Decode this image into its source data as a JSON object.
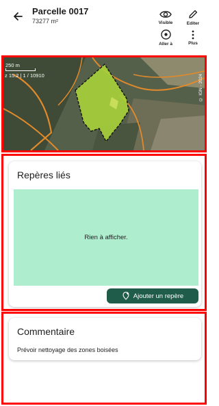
{
  "header": {
    "back_icon": "arrow-left-icon",
    "title": "Parcelle 0017",
    "subtitle": "73277 m²",
    "actions": [
      {
        "label": "Visible",
        "icon": "eye-icon"
      },
      {
        "label": "Editer",
        "icon": "pencil-icon"
      },
      {
        "label": "Aller à",
        "icon": "target-icon"
      },
      {
        "label": "Plus",
        "icon": "more-vertical-icon"
      }
    ]
  },
  "map": {
    "scale_label": "250 m",
    "zoom_label": "z 15.2 | 1 / 10910",
    "copyright": "© IGN - 2024",
    "colors": {
      "parcel_fill": "#a9d13a",
      "road": "#e08a2c",
      "highlight_border": "#ff0000"
    }
  },
  "linked": {
    "title": "Repères liés",
    "empty_text": "Rien à afficher.",
    "add_label": "Ajouter un repère",
    "add_icon": "add-marker-icon",
    "colors": {
      "empty_bg": "#aeedce",
      "button_bg": "#1f5c4a"
    }
  },
  "comment": {
    "title": "Commentaire",
    "text": "Prévoir nettoyage des zones boisées"
  }
}
